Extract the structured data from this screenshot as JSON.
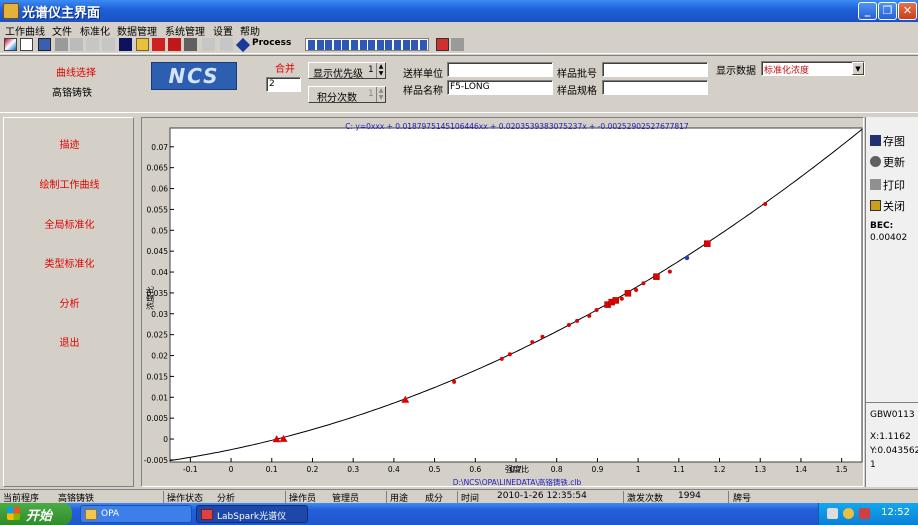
{
  "window": {
    "title": "光谱仪主界面"
  },
  "menu": [
    "工作曲线",
    "文件",
    "标准化",
    "数据管理",
    "系统管理",
    "设置",
    "帮助"
  ],
  "toolbar": {
    "process_label": "Process",
    "progress_segments": 14
  },
  "controls": {
    "curve_select_label": "曲线选择",
    "curve_name": "高铬铸铁",
    "logo_text": "NCS",
    "merge_label": "合并",
    "merge_value": "2",
    "priority_label": "显示优先级",
    "priority_value": "1",
    "integration_label": "积分次数",
    "integration_value": "1",
    "sender_label": "送样单位",
    "sender_value": "",
    "sample_name_label": "样品名称",
    "sample_name_value": "F5-LONG",
    "batch_label": "样品批号",
    "batch_value": "",
    "spec_label": "样品规格",
    "spec_value": "",
    "display_label": "显示数据",
    "display_value": "标准化浓度"
  },
  "left_menu": [
    "描迹",
    "绘制工作曲线",
    "全局标准化",
    "类型标准化",
    "分析",
    "退出"
  ],
  "chart_data": {
    "type": "scatter",
    "equation": "C: y=0xxx + 0.0187975145106446xx + 0.0203539383075237x + -0.00252902527677817",
    "xlabel": "强度比",
    "ylabel": "浓度比",
    "file_path": "D:\\NCS\\OPA\\LINEDATA\\高铬铸铁.clb",
    "xlim": [
      -0.15,
      1.55
    ],
    "ylim": [
      -0.0055,
      0.0745
    ],
    "x_ticks": [
      -0.1,
      0,
      0.1,
      0.2,
      0.3,
      0.4,
      0.5,
      0.6,
      0.7,
      0.8,
      0.9,
      1,
      1.1,
      1.2,
      1.3,
      1.4,
      1.5
    ],
    "y_ticks": [
      -0.005,
      0,
      0.005,
      0.01,
      0.015,
      0.02,
      0.025,
      0.03,
      0.035,
      0.04,
      0.045,
      0.05,
      0.055,
      0.06,
      0.065,
      0.07
    ],
    "curve": {
      "a3": 0,
      "a2": 0.0187975145106446,
      "a1": 0.0203539383075237,
      "a0": -0.00252902527677817
    },
    "colors": {
      "curve": "#000000",
      "point": "#e00000",
      "highlight": "#2040c0",
      "equation": "#2020c0"
    },
    "points_dot": [
      [
        0.548,
        0.0137
      ],
      [
        0.665,
        0.0192
      ],
      [
        0.685,
        0.0203
      ],
      [
        0.74,
        0.0232
      ],
      [
        0.765,
        0.0245
      ],
      [
        0.83,
        0.0273
      ],
      [
        0.85,
        0.0283
      ],
      [
        0.88,
        0.0295
      ],
      [
        0.898,
        0.0309
      ],
      [
        0.96,
        0.0336
      ],
      [
        0.995,
        0.0357
      ],
      [
        1.013,
        0.0373
      ],
      [
        1.078,
        0.0401
      ],
      [
        1.312,
        0.0563
      ]
    ],
    "points_triangle": [
      [
        0.112,
        -5e-05
      ],
      [
        0.129,
        5e-05
      ],
      [
        0.428,
        0.0094
      ]
    ],
    "points_square": [
      [
        0.925,
        0.0322
      ],
      [
        0.935,
        0.0328
      ],
      [
        0.945,
        0.0332
      ],
      [
        0.975,
        0.0349
      ],
      [
        1.045,
        0.0389
      ],
      [
        1.17,
        0.0468
      ]
    ],
    "points_highlight": [
      [
        1.12,
        0.0434
      ]
    ]
  },
  "right_panel": {
    "save_label": "存图",
    "update_label": "更新",
    "print_label": "打印",
    "close_label": "关闭",
    "bec_label": "BEC:",
    "bec_value": "0.00402",
    "element": "GBW0113",
    "x_readout": "X:1.1162",
    "y_readout": "Y:0.043562",
    "extra": "1"
  },
  "statusbar": {
    "program_label": "当前程序",
    "program_value": "高铬铸铁",
    "state_label": "操作状态",
    "state_value": "分析",
    "operator_label": "操作员",
    "operator_value": "管理员",
    "use_label": "用途",
    "use_value": "成分",
    "time_label": "时间",
    "time_value": "2010-1-26 12:35:54",
    "shots_label": "激发次数",
    "shots_value": "1994",
    "brand_label": "牌号",
    "brand_value": ""
  },
  "taskbar": {
    "start_label": "开始",
    "tasks": [
      "OPA",
      "LabSpark光谱仪"
    ],
    "clock": "12:52"
  }
}
